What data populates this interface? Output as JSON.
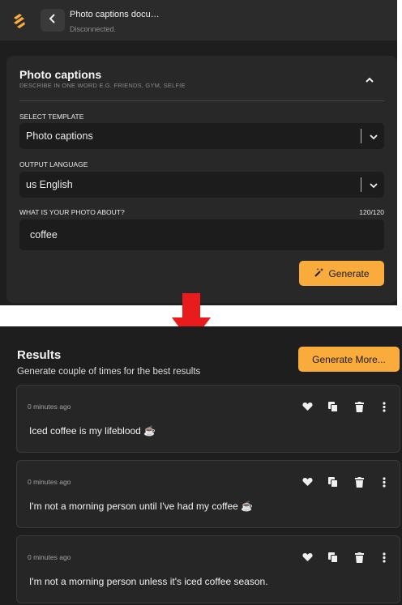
{
  "header": {
    "doc_title": "Photo captions docu…",
    "status": "Disconnected.",
    "back_icon": "chevron-left-icon",
    "logo_icon": "app-logo-icon"
  },
  "form": {
    "title": "Photo captions",
    "subtitle": "DESCRIBE IN ONE WORD E.G. FRIENDS, GYM, SELFIE",
    "template_label": "SELECT TEMPLATE",
    "template_value": "Photo captions",
    "language_label": "OUTPUT LANGUAGE",
    "language_value": "us English",
    "about_label": "WHAT IS YOUR PHOTO ABOUT?",
    "counter": "120/120",
    "about_value": "coffee",
    "generate_label": "Generate",
    "generate_icon": "magic-wand-icon"
  },
  "results": {
    "title": "Results",
    "subtitle": "Generate couple of times for the best results",
    "more_label": "Generate More...",
    "items": [
      {
        "time": "0 minutes ago",
        "text": "Iced coffee is my lifeblood ☕"
      },
      {
        "time": "0 minutes ago",
        "text": "I'm not a morning person until I've had my coffee ☕"
      },
      {
        "time": "0 minutes ago",
        "text": "I'm not a morning person unless it's iced coffee season."
      }
    ]
  },
  "colors": {
    "accent": "#f9ab3c",
    "panel": "#1e1e1e",
    "card": "#282828",
    "arrow": "#e81c1c"
  }
}
